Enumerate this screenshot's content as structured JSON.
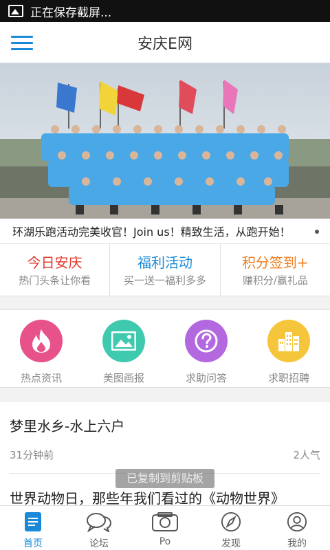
{
  "status_bar": {
    "text": "正在保存截屏..."
  },
  "header": {
    "title": "安庆E网"
  },
  "ticker": {
    "text": "环湖乐跑活动完美收官！Join us！精致生活，从跑开始！"
  },
  "promos": [
    {
      "title": "今日安庆",
      "subtitle": "热门头条让你看",
      "color": "#e03a2e"
    },
    {
      "title": "福利活动",
      "subtitle": "买一送一福利多多",
      "color": "#1a8ad8"
    },
    {
      "title": "积分签到+",
      "subtitle": "赚积分/赢礼品",
      "color": "#f07c1e"
    }
  ],
  "categories": [
    {
      "label": "热点资讯",
      "icon": "fire-icon",
      "color": "#e8528a"
    },
    {
      "label": "美图画报",
      "icon": "picture-icon",
      "color": "#3fc9ae"
    },
    {
      "label": "求助问答",
      "icon": "question-icon",
      "color": "#b368e0"
    },
    {
      "label": "求职招聘",
      "icon": "building-icon",
      "color": "#f5c63c"
    }
  ],
  "news": [
    {
      "title": "梦里水乡-水上六户",
      "time": "31分钟前",
      "popularity": "2人气"
    },
    {
      "title": "世界动物日，那些年我们看过的《动物世界》"
    }
  ],
  "toast": {
    "text": "已复制到剪贴板"
  },
  "tabs": [
    {
      "label": "首页",
      "icon": "home-doc-icon",
      "active": true
    },
    {
      "label": "论坛",
      "icon": "chat-bubbles-icon"
    },
    {
      "label": "Po",
      "icon": "camera-icon"
    },
    {
      "label": "发现",
      "icon": "compass-icon"
    },
    {
      "label": "我的",
      "icon": "user-icon"
    }
  ],
  "colors": {
    "accent": "#1a8ad8"
  }
}
